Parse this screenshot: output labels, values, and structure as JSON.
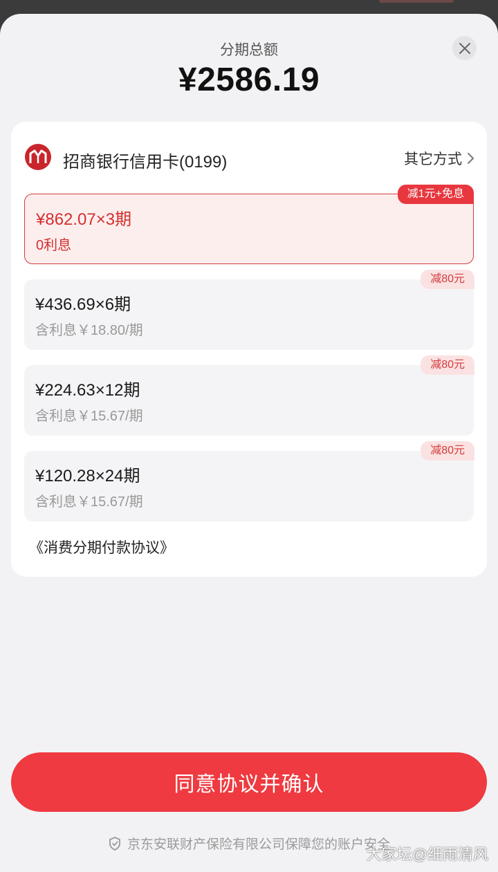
{
  "header": {
    "total_label": "分期总额",
    "total_amount": "¥2586.19"
  },
  "icons": {
    "close": "close-icon",
    "bank_logo": "cmb-logo-icon",
    "chevron": "chevron-right-icon",
    "shield": "shield-icon"
  },
  "payment": {
    "bank_name": "招商银行信用卡(0199)",
    "other_methods_label": "其它方式"
  },
  "plans": [
    {
      "amount": "¥862.07×3期",
      "interest": "0利息",
      "badge": "减1元+免息",
      "selected": true
    },
    {
      "amount": "¥436.69×6期",
      "interest": "含利息￥18.80/期",
      "badge": "减80元",
      "selected": false
    },
    {
      "amount": "¥224.63×12期",
      "interest": "含利息￥15.67/期",
      "badge": "减80元",
      "selected": false
    },
    {
      "amount": "¥120.28×24期",
      "interest": "含利息￥15.67/期",
      "badge": "减80元",
      "selected": false
    }
  ],
  "agreement_label": "《消费分期付款协议》",
  "confirm_label": "同意协议并确认",
  "footer_text": "京东安联财产保险有限公司保障您的账户安全",
  "watermark": "大家坛@细雨清风",
  "colors": {
    "accent": "#ee3a40",
    "selected_text": "#d32f2f",
    "bank_red": "#c9252c"
  }
}
